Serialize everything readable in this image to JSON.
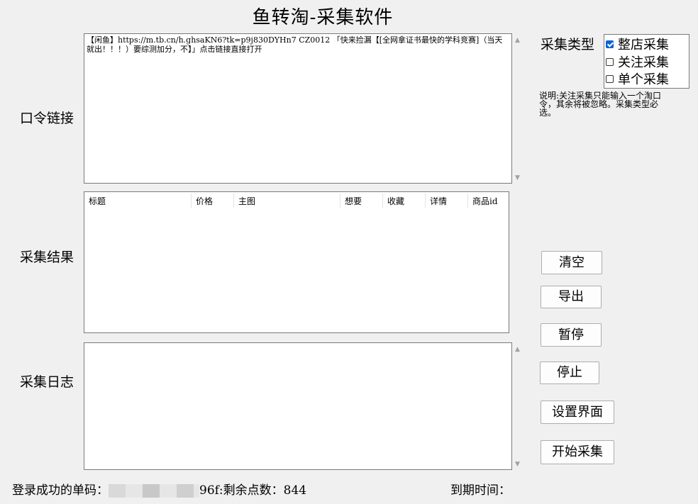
{
  "app": {
    "title": "鱼转淘-采集软件"
  },
  "labels": {
    "link": "口令链接",
    "results": "采集结果",
    "log": "采集日志",
    "collect_type": "采集类型"
  },
  "link_input": {
    "value": "【闲鱼】https://m.tb.cn/h.ghsaKN6?tk=p9j830DYHn7 CZ0012 「快来捡漏【[全网拿证书最快的学科竞赛]（当天就出！！！）要综测加分，不】」点击链接直接打开"
  },
  "results_table": {
    "columns": [
      "标题",
      "价格",
      "主图",
      "想要",
      "收藏",
      "详情",
      "商品id"
    ],
    "rows": []
  },
  "log": {
    "value": ""
  },
  "collect_types": [
    {
      "label": "整店采集",
      "checked": true
    },
    {
      "label": "关注采集",
      "checked": false
    },
    {
      "label": "单个采集",
      "checked": false
    }
  ],
  "note": "说明:关注采集只能输入一个淘口令，其余将被忽略。采集类型必选。",
  "buttons": {
    "clear": "清空",
    "export": "导出",
    "pause": "暂停",
    "stop": "停止",
    "settings": "设置界面",
    "start": "开始采集"
  },
  "footer": {
    "login_label": "登录成功的单码：",
    "code_tail": "96f:",
    "points_label": "剩余点数：",
    "points": "844",
    "expire_label": "到期时间："
  }
}
